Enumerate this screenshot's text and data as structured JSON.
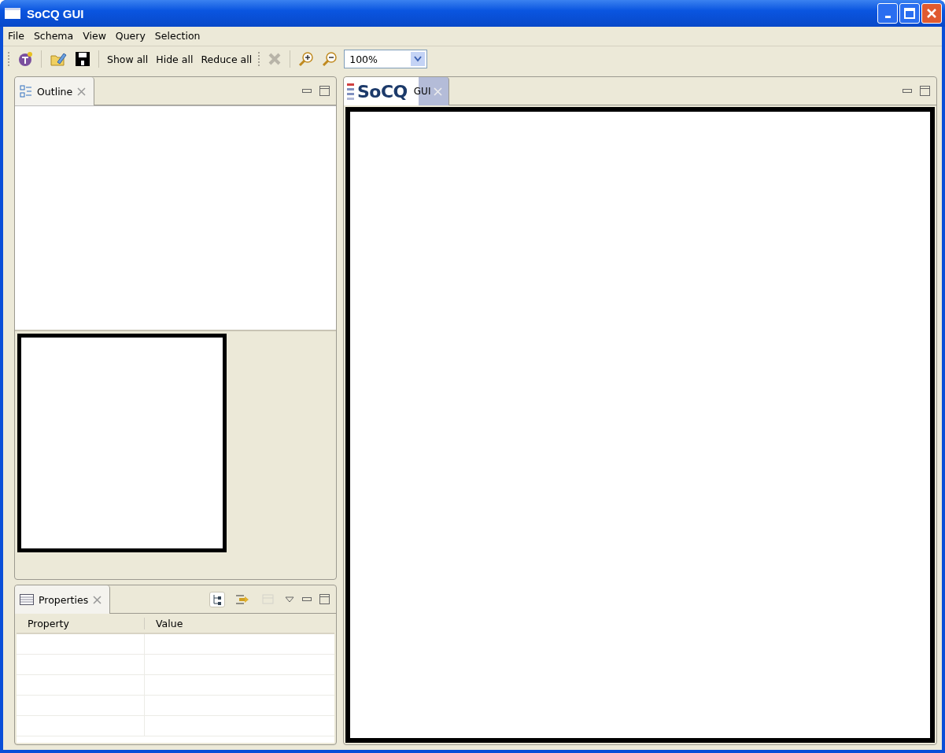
{
  "window": {
    "title": "SoCQ GUI"
  },
  "menu": [
    "File",
    "Schema",
    "View",
    "Query",
    "Selection"
  ],
  "toolbar": [
    {
      "kind": "query"
    },
    {
      "kind": "separator"
    },
    {
      "kind": "open"
    },
    {
      "kind": "save"
    },
    {
      "kind": "separator"
    },
    {
      "kind": "text",
      "label": "Show all"
    },
    {
      "kind": "text",
      "label": "Hide all"
    },
    {
      "kind": "text",
      "label": "Reduce all"
    },
    {
      "kind": "grip"
    },
    {
      "kind": "delete",
      "disabled": true
    },
    {
      "kind": "separator"
    },
    {
      "kind": "zoomin"
    },
    {
      "kind": "zoomout"
    },
    {
      "kind": "combo",
      "value": "100%"
    }
  ],
  "outline": {
    "tab": {
      "label": "Outline",
      "selected": true
    }
  },
  "properties": {
    "tab": {
      "label": "Properties",
      "selected": true
    },
    "tools": [
      {
        "kind": "tree",
        "selected": true
      },
      {
        "kind": "filter",
        "selected": false
      },
      {
        "kind": "advanced",
        "selected": false,
        "disabled": true
      }
    ],
    "table": {
      "columns": [
        "Property",
        "Value"
      ]
    }
  },
  "editor": {
    "tab": {
      "logo": "SoCQ",
      "label": "GUI",
      "selected": true
    }
  }
}
